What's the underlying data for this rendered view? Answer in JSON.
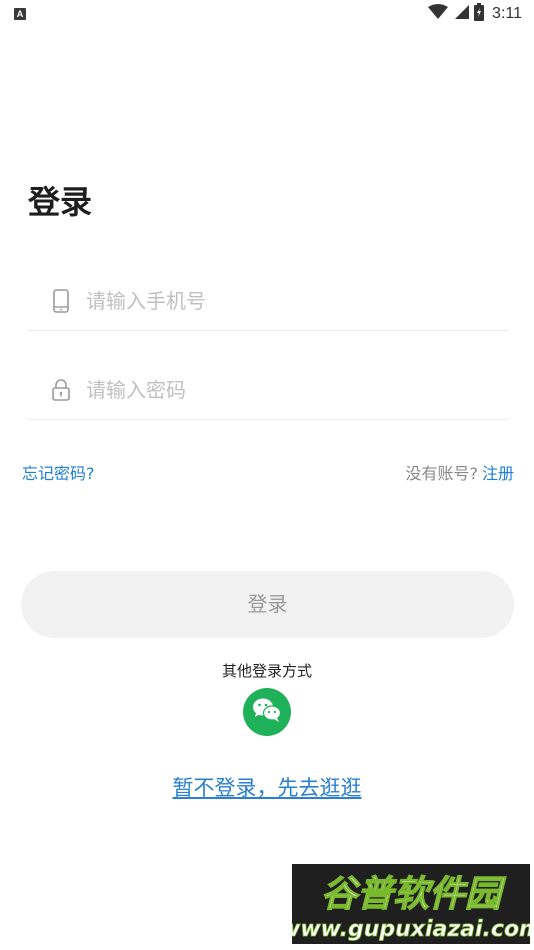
{
  "status_bar": {
    "indicator": "A",
    "time": "3:11",
    "icons": [
      "wifi-icon",
      "cellular-signal-icon",
      "battery-icon"
    ]
  },
  "login": {
    "title": "登录",
    "phone_placeholder": "请输入手机号",
    "password_placeholder": "请输入密码",
    "forgot_password": "忘记密码?",
    "no_account": "没有账号?",
    "register": "注册",
    "login_button": "登录",
    "other_methods_label": "其他登录方式",
    "skip": "暂不登录，先去逛逛"
  },
  "colors": {
    "link_blue": "#1d7fd6",
    "wechat_green": "#1fb159",
    "button_bg": "#f2f2f2"
  },
  "watermark": {
    "name": "谷普软件园",
    "url": "www.gupuxiazai.com"
  }
}
